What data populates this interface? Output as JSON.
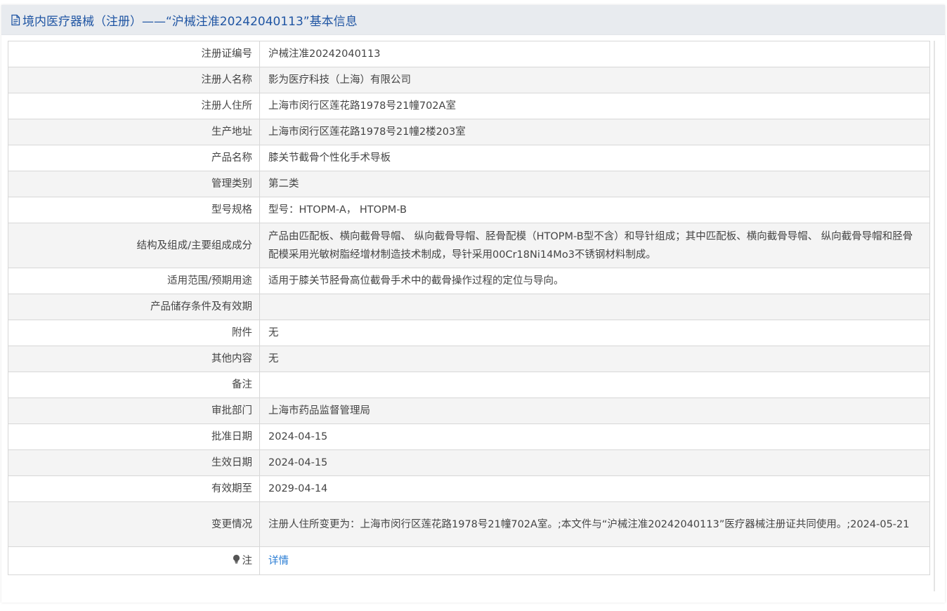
{
  "header": {
    "title": "境内医疗器械（注册）——“沪械注准20242040113”基本信息",
    "icon": "document-icon",
    "color": "#1f55a3"
  },
  "rows": [
    {
      "label": "注册证编号",
      "value": "沪械注准20242040113"
    },
    {
      "label": "注册人名称",
      "value": "影为医疗科技（上海）有限公司"
    },
    {
      "label": "注册人住所",
      "value": "上海市闵行区莲花路1978号21幢702A室"
    },
    {
      "label": "生产地址",
      "value": "上海市闵行区莲花路1978号21幢2楼203室"
    },
    {
      "label": "产品名称",
      "value": "膝关节截骨个性化手术导板"
    },
    {
      "label": "管理类别",
      "value": "第二类"
    },
    {
      "label": "型号规格",
      "value": "型号：HTOPM-A， HTOPM-B"
    },
    {
      "label": "结构及组成/主要组成成分",
      "value": "产品由匹配板、横向截骨导帽、 纵向截骨导帽、胫骨配模（HTOPM-B型不含）和导针组成；其中匹配板、横向截骨导帽、 纵向截骨导帽和胫骨配模采用光敏树脂经增材制造技术制成，导针采用00Cr18Ni14Mo3不锈钢材料制成。"
    },
    {
      "label": "适用范围/预期用途",
      "value": "适用于膝关节胫骨高位截骨手术中的截骨操作过程的定位与导向。"
    },
    {
      "label": "产品储存条件及有效期",
      "value": ""
    },
    {
      "label": "附件",
      "value": "无"
    },
    {
      "label": "其他内容",
      "value": "无"
    },
    {
      "label": "备注",
      "value": ""
    },
    {
      "label": "审批部门",
      "value": "上海市药品监督管理局"
    },
    {
      "label": "批准日期",
      "value": "2024-04-15"
    },
    {
      "label": "生效日期",
      "value": "2024-04-15"
    },
    {
      "label": "有效期至",
      "value": "2029-04-14"
    },
    {
      "label": "变更情况",
      "value": "注册人住所变更为：上海市闵行区莲花路1978号21幢702A室。;本文件与“沪械注准20242040113”医疗器械注册证共同使用。;2024-05-21"
    }
  ],
  "note": {
    "label": "注",
    "icon": "lightbulb-icon",
    "link": "详情",
    "link_color": "#2a7dd4"
  }
}
